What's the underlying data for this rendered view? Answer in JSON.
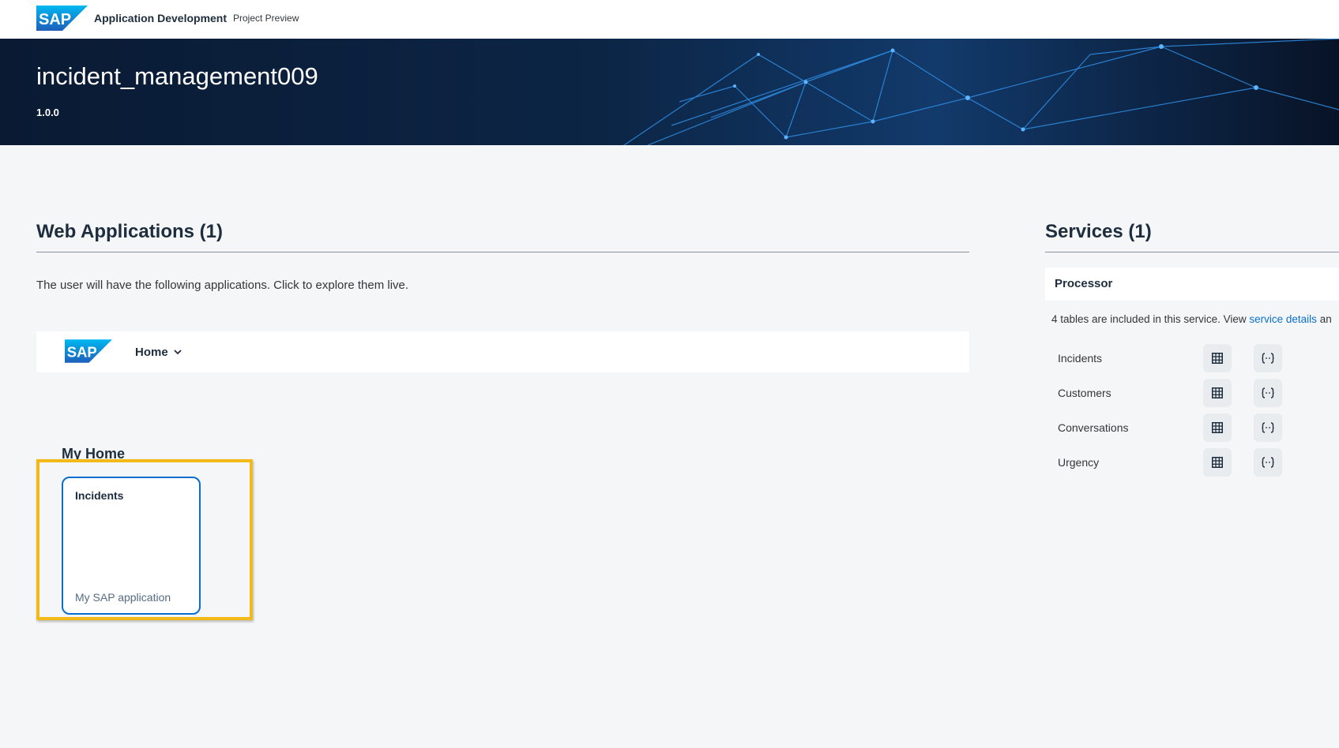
{
  "shell": {
    "logo_text": "SAP",
    "title": "Application Development",
    "subtitle": "Project Preview"
  },
  "hero": {
    "title": "incident_management009",
    "version": "1.0.0"
  },
  "web_applications": {
    "heading": "Web Applications (1)",
    "description": "The user will have the following applications. Click to explore them live.",
    "shellbar": {
      "logo_text": "SAP",
      "home_label": "Home"
    },
    "group_title": "My Home",
    "tiles": [
      {
        "title": "Incidents",
        "subtitle": "My SAP application"
      }
    ],
    "highlight_color": "#f2b919"
  },
  "services": {
    "heading": "Services (1)",
    "items": [
      {
        "name": "Processor",
        "description_prefix": "4 tables are included in this service. View ",
        "link_text": "service details",
        "description_suffix": " an",
        "entities": [
          {
            "name": "Incidents",
            "table_icon": "table-icon",
            "api_icon": "api-braces-icon"
          },
          {
            "name": "Customers",
            "table_icon": "table-icon",
            "api_icon": "api-braces-icon"
          },
          {
            "name": "Conversations",
            "table_icon": "table-icon",
            "api_icon": "api-braces-icon"
          },
          {
            "name": "Urgency",
            "table_icon": "table-icon",
            "api_icon": "api-braces-icon"
          }
        ]
      }
    ]
  },
  "colors": {
    "brand_blue": "#0a6ed1",
    "hero_background": "#0a1a33",
    "page_background": "#f5f6f7",
    "text": "#1d2d3e"
  }
}
